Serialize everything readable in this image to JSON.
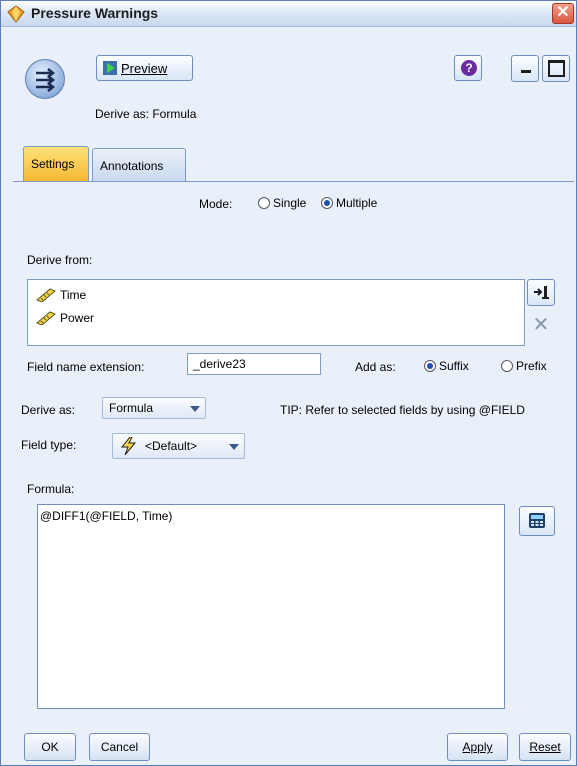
{
  "window": {
    "title": "Pressure Warnings",
    "close_glyph": "✕"
  },
  "toolbar": {
    "preview_label": "Preview",
    "help_glyph": "?",
    "derive_as_caption": "Derive as: Formula"
  },
  "tabs": [
    {
      "label": "Settings",
      "active": true
    },
    {
      "label": "Annotations",
      "active": false
    }
  ],
  "mode": {
    "label": "Mode:",
    "options": [
      {
        "label": "Single",
        "selected": false
      },
      {
        "label": "Multiple",
        "selected": true
      }
    ]
  },
  "derive_from": {
    "label": "Derive from:",
    "fields": [
      {
        "label": "Time",
        "icon": "ruler-icon"
      },
      {
        "label": "Power",
        "icon": "ruler-icon"
      }
    ]
  },
  "extension": {
    "label": "Field name extension:",
    "value": "_derive23",
    "add_as_label": "Add as:",
    "options": [
      {
        "label": "Suffix",
        "selected": true
      },
      {
        "label": "Prefix",
        "selected": false
      }
    ]
  },
  "derive_as": {
    "label": "Derive as:",
    "value": "Formula",
    "tip": "TIP: Refer to selected fields by using @FIELD"
  },
  "field_type": {
    "label": "Field type:",
    "value": "<Default>"
  },
  "formula": {
    "label": "Formula:",
    "value": "@DIFF1(@FIELD, Time)"
  },
  "buttons": {
    "ok": "OK",
    "cancel": "Cancel",
    "apply": "Apply",
    "reset": "Reset"
  },
  "colors": {
    "active_tab": "#f5b733",
    "radio_dot": "#1d4fae",
    "close": "#d9563b"
  }
}
